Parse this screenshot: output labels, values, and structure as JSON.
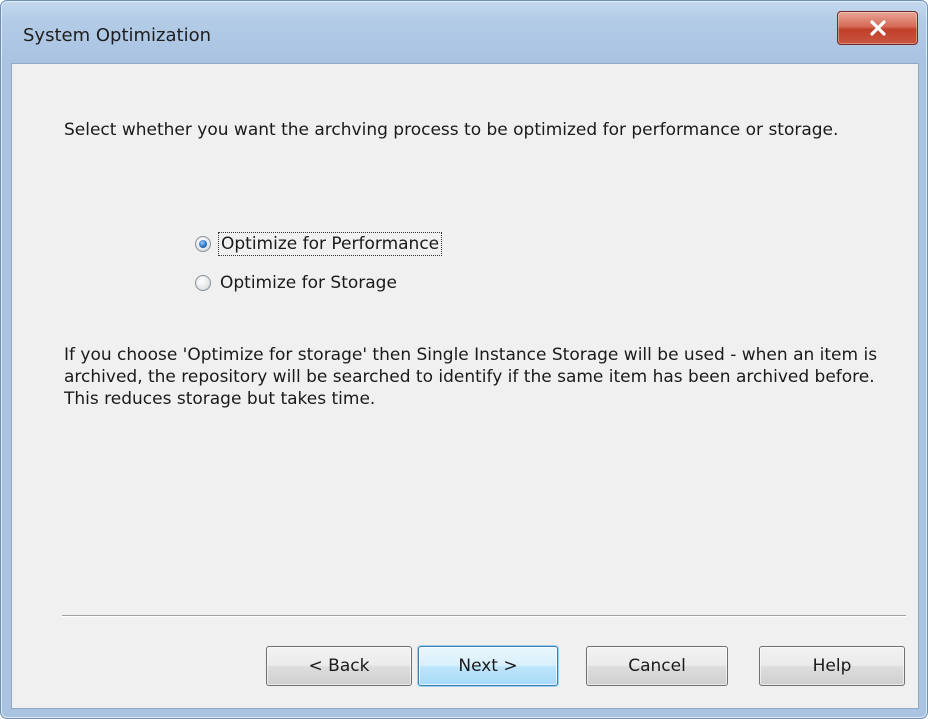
{
  "window": {
    "title": "System Optimization",
    "close_label": "close"
  },
  "content": {
    "intro": "Select whether you want the archving process to be optimized for performance or storage.",
    "options": [
      {
        "label": "Optimize for Performance",
        "selected": true
      },
      {
        "label": "Optimize for Storage",
        "selected": false
      }
    ],
    "explanation": "If you choose 'Optimize for storage' then Single Instance Storage will be used - when an item is archived, the repository will be searched to identify if the same item has been archived before. This reduces storage but takes time."
  },
  "buttons": {
    "back": "< Back",
    "next": "Next >",
    "cancel": "Cancel",
    "help": "Help"
  },
  "colors": {
    "close_button": "#c9553f",
    "default_button_border": "#3c7fb1"
  }
}
